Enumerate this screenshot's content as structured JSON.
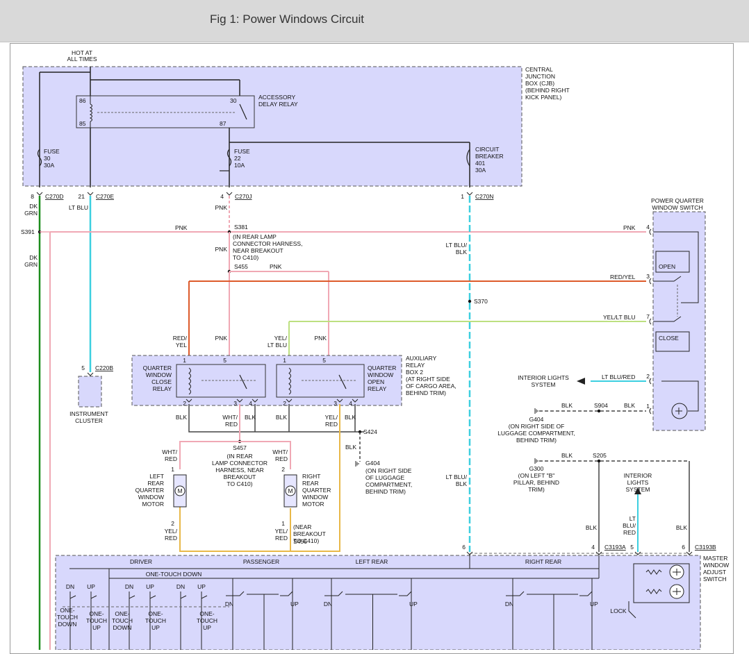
{
  "header": {
    "title": "Fig 1: Power Windows Circuit"
  },
  "colors": {
    "box_fill": "#d8d8fc",
    "pnk": "#f0a8b4",
    "red_yel": "#dd5a2a",
    "lt_blu": "#3ccfe0",
    "dk_grn": "#1c8c1c",
    "yel": "#e8b848",
    "yel_lt_blu": "#bde080",
    "black": "#444444"
  },
  "labels": {
    "hot_at_all_times": [
      "HOT AT",
      "ALL TIMES"
    ],
    "cjb": [
      "CENTRAL",
      "JUNCTION",
      "BOX (CJB)",
      "(BEHIND RIGHT",
      "KICK PANEL)"
    ],
    "accessory_relay": [
      "ACCESSORY",
      "DELAY RELAY"
    ],
    "fuse30": [
      "FUSE",
      "30",
      "30A"
    ],
    "fuse22": [
      "FUSE",
      "22",
      "10A"
    ],
    "breaker": [
      "CIRCUIT",
      "BREAKER",
      "401",
      "30A"
    ],
    "pin86": "86",
    "pin85": "85",
    "pin30": "30",
    "pin87": "87",
    "c270d": "C270D",
    "c270e": "C270E",
    "c270j": "C270J",
    "c270n": "C270N",
    "pin8": "8",
    "pin21": "21",
    "pin4": "4",
    "pin1": "1",
    "dk_grn": [
      "DK",
      "GRN"
    ],
    "lt_blu": "LT BLU",
    "pnk": "PNK",
    "s391": "S391",
    "s381": "S381",
    "s381_note": [
      "(IN REAR LAMP",
      "CONNECTOR HARNESS,",
      "NEAR BREAKOUT",
      "TO C410)"
    ],
    "s455": "S455",
    "s370": "S370",
    "lt_blu_blk": [
      "LT BLU/",
      "BLK"
    ],
    "red_yel": "RED/YEL",
    "yel_lt_blu": "YEL/LT BLU",
    "lt_blu_red": "LT BLU/RED",
    "red_yel_stack": [
      "RED/",
      "YEL"
    ],
    "yel_lt_blu_stack": [
      "YEL/",
      "LT BLU"
    ],
    "pqws": [
      "POWER QUARTER",
      "WINDOW SWITCH"
    ],
    "open": "OPEN",
    "close": "CLOSE",
    "aux_relay": [
      "AUXILIARY",
      "RELAY",
      "BOX 2",
      "(AT RIGHT SIDE",
      "OF CARGO AREA,",
      "BEHIND TRIM)"
    ],
    "qw_close_relay": [
      "QUARTER",
      "WINDOW",
      "CLOSE",
      "RELAY"
    ],
    "qw_open_relay": [
      "QUARTER",
      "WINDOW",
      "OPEN",
      "RELAY"
    ],
    "c220b": "C220B",
    "instrument_cluster": [
      "INSTRUMENT",
      "CLUSTER"
    ],
    "interior_lights": [
      "INTERIOR LIGHTS",
      "SYSTEM"
    ],
    "interior_lights2": [
      "INTERIOR",
      "LIGHTS",
      "SYSTEM"
    ],
    "blk": "BLK",
    "s904": "S904",
    "g404": "G404",
    "g404_note": [
      "(ON RIGHT SIDE OF",
      "LUGGAGE COMPARTMENT,",
      "BEHIND TRIM)"
    ],
    "g404b_note": [
      "(ON RIGHT SIDE",
      "OF LUGGAGE",
      "COMPARTMENT,",
      "BEHIND TRIM)"
    ],
    "s424": "S424",
    "s205": "S205",
    "g300": "G300",
    "g300_note": [
      "(ON LEFT \"B\"",
      "PILLAR, BEHIND",
      "TRIM)"
    ],
    "wht_red": [
      "WHT/",
      "RED"
    ],
    "yel_red": [
      "YEL/",
      "RED"
    ],
    "s457": "S457",
    "s457_note": [
      "(IN REAR",
      "LAMP CONNECTOR",
      "HARNESS, NEAR",
      "BREAKOUT",
      "TO C410)"
    ],
    "left_motor": [
      "LEFT",
      "REAR",
      "QUARTER",
      "WINDOW",
      "MOTOR"
    ],
    "right_motor": [
      "RIGHT",
      "REAR",
      "QUARTER",
      "WINDOW",
      "MOTOR"
    ],
    "s456_note": [
      "(NEAR",
      "BREAKOUT",
      "TO C410)"
    ],
    "s456": "S456",
    "lt_blu_red_stack": [
      "LT",
      "BLU/",
      "RED"
    ],
    "c3193a": "C3193A",
    "c3193b": "C3193B",
    "master_switch": [
      "MASTER",
      "WINDOW",
      "ADJUST",
      "SWITCH"
    ],
    "driver": "DRIVER",
    "passenger": "PASSENGER",
    "left_rear": "LEFT REAR",
    "right_rear": "RIGHT REAR",
    "one_touch_down": "ONE-TOUCH DOWN",
    "dn": "DN",
    "up": "UP",
    "lock": "LOCK",
    "ot_down": [
      "ONE-",
      "TOUCH",
      "DOWN"
    ],
    "ot_up": [
      "ONE-",
      "TOUCH",
      "UP"
    ],
    "m": "M",
    "pins": {
      "p1": "1",
      "p2": "2",
      "p3": "3",
      "p4": "4",
      "p5": "5",
      "p6": "6",
      "p7": "7"
    }
  }
}
